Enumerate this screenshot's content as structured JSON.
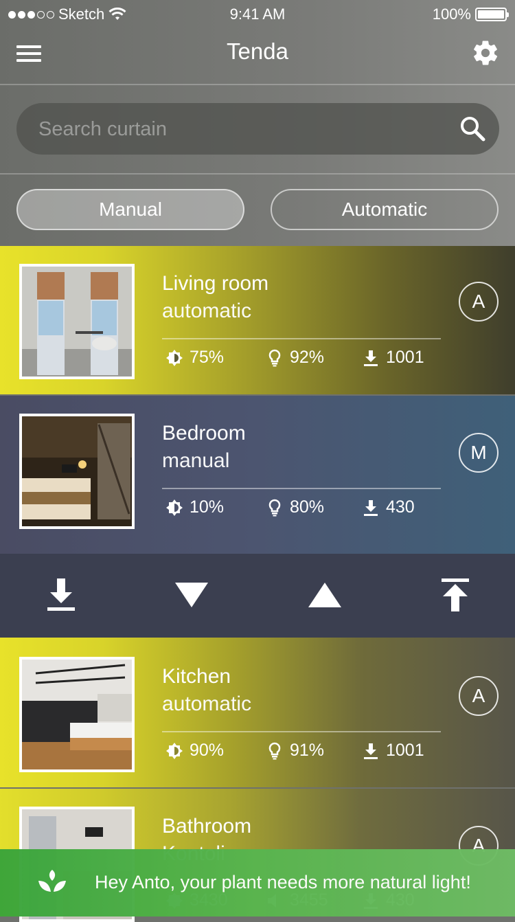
{
  "status_bar": {
    "carrier": "Sketch",
    "time": "9:41 AM",
    "battery": "100%",
    "signal_bars_filled": 3,
    "signal_bars_total": 5
  },
  "header": {
    "title": "Tenda",
    "menu_icon": "hamburger-menu-icon",
    "settings_icon": "gear-icon"
  },
  "search": {
    "placeholder": "Search curtain",
    "value": "",
    "icon": "search-icon"
  },
  "filters": {
    "manual_label": "Manual",
    "automatic_label": "Automatic",
    "selected": "Manual"
  },
  "rooms": [
    {
      "name": "Living room",
      "mode": "automatic",
      "badge": "A",
      "stats": {
        "brightness": "75%",
        "light": "92%",
        "position": "1001"
      }
    },
    {
      "name": "Bedroom",
      "mode": "manual",
      "badge": "M",
      "stats": {
        "brightness": "10%",
        "light": "80%",
        "position": "430"
      }
    },
    {
      "name": "Kitchen",
      "mode": "automatic",
      "badge": "A",
      "stats": {
        "brightness": "90%",
        "light": "91%",
        "position": "1001"
      }
    },
    {
      "name": "Bathroom",
      "mode": "Kontoli",
      "badge": "A",
      "stats": {
        "brightness": "3430",
        "light": "3455",
        "position": "430"
      }
    }
  ],
  "controls": {
    "icons": [
      "download-bottom-icon",
      "triangle-down-icon",
      "triangle-up-icon",
      "upload-top-icon"
    ]
  },
  "notification": {
    "message": "Hey Anto, your plant needs more natural light!",
    "icon": "plant-icon"
  },
  "colors": {
    "accent_yellow": "#e8e22a",
    "bedroom_blue": "#3f6079",
    "controls_bg": "#3b3f50",
    "toast_green": "#4caf50"
  }
}
